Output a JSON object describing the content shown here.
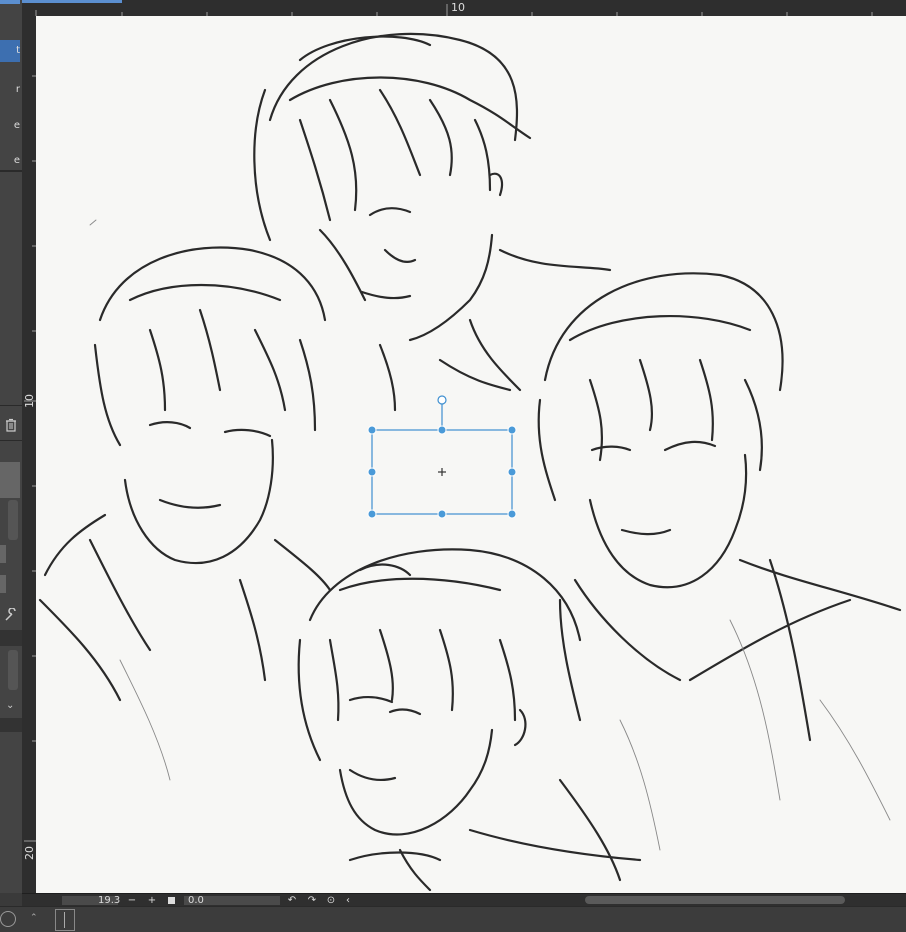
{
  "left_panel": {
    "labels": [
      "t",
      "r",
      "e",
      "e"
    ]
  },
  "rulers": {
    "top_label": "10",
    "left_labels": [
      "10",
      "20"
    ]
  },
  "status": {
    "zoom": "19.3",
    "minus": "−",
    "plus": "+",
    "angle": "0.0"
  },
  "transform_box": {
    "color": "#3e8fd0"
  },
  "icons": {
    "trash": "trash-icon",
    "wrench": "wrench-icon",
    "rotate_left": "rotate-left-icon",
    "rotate_right": "rotate-right-icon",
    "reset": "reset-rotation-icon",
    "chevron": "chevron-left-icon",
    "flip": "flip-icon"
  }
}
